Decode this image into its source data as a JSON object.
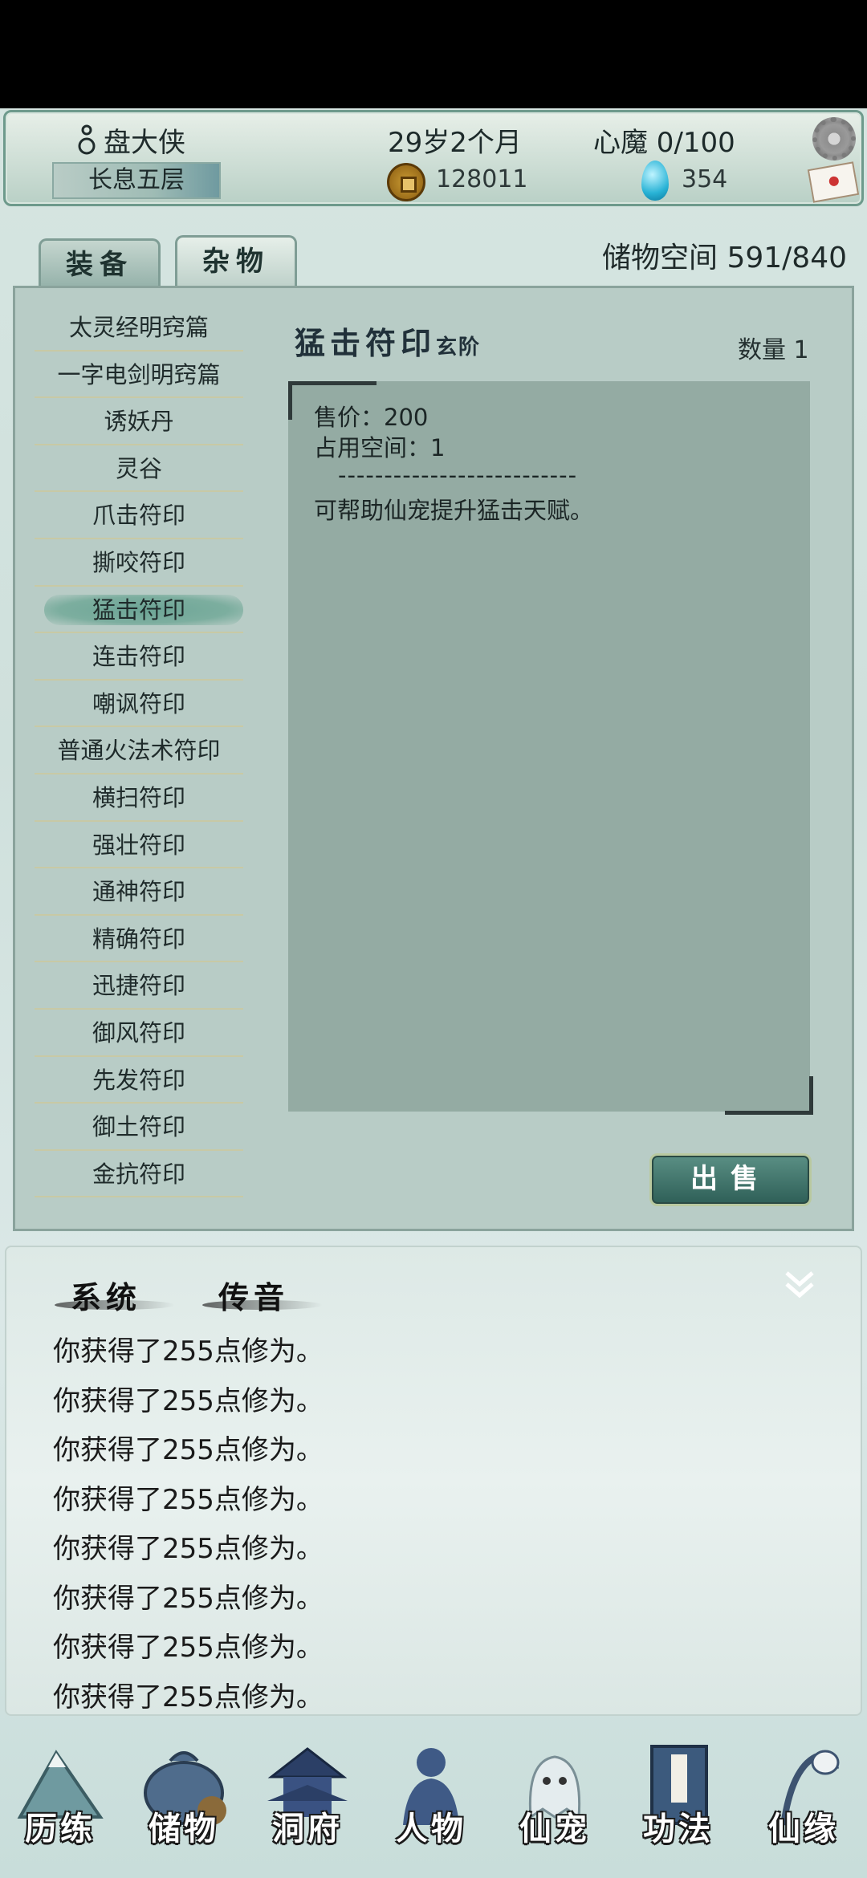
{
  "header": {
    "name": "盘大侠",
    "realm": "长息五层",
    "age": "29岁2个月",
    "demon": "心魔  0/100",
    "coins": "128011",
    "gems": "354"
  },
  "tabs": [
    {
      "label": "装备"
    },
    {
      "label": "杂物"
    }
  ],
  "storage": "储物空间 591/840",
  "items": [
    "太灵经明窍篇",
    "一字电剑明窍篇",
    "诱妖丹",
    "灵谷",
    "爪击符印",
    "撕咬符印",
    "猛击符印",
    "连击符印",
    "嘲讽符印",
    "普通火法术符印",
    "横扫符印",
    "强壮符印",
    "通神符印",
    "精确符印",
    "迅捷符印",
    "御风符印",
    "先发符印",
    "御土符印",
    "金抗符印"
  ],
  "detail": {
    "title": "猛击符印",
    "grade": "玄阶",
    "quantity": "数量 1",
    "price": "售价：200",
    "space": "占用空间：1",
    "divider": "--------------------------",
    "description": "可帮助仙宠提升猛击天赋。",
    "sell_label": "出售"
  },
  "log": {
    "tab_system": "系统",
    "tab_message": "传音",
    "lines": [
      "你获得了255点修为。",
      "你获得了255点修为。",
      "你获得了255点修为。",
      "你获得了255点修为。",
      "你获得了255点修为。",
      "你获得了255点修为。",
      "你获得了255点修为。",
      "你获得了255点修为。"
    ]
  },
  "nav": [
    {
      "label": "历练"
    },
    {
      "label": "储物"
    },
    {
      "label": "洞府"
    },
    {
      "label": "人物"
    },
    {
      "label": "仙宠"
    },
    {
      "label": "功法"
    },
    {
      "label": "仙缘"
    }
  ],
  "colors": {
    "panel": "#b8ccc6",
    "desc_box": "#94aba3",
    "selected": "#7cae9f",
    "sell_button": "#3f756b"
  }
}
